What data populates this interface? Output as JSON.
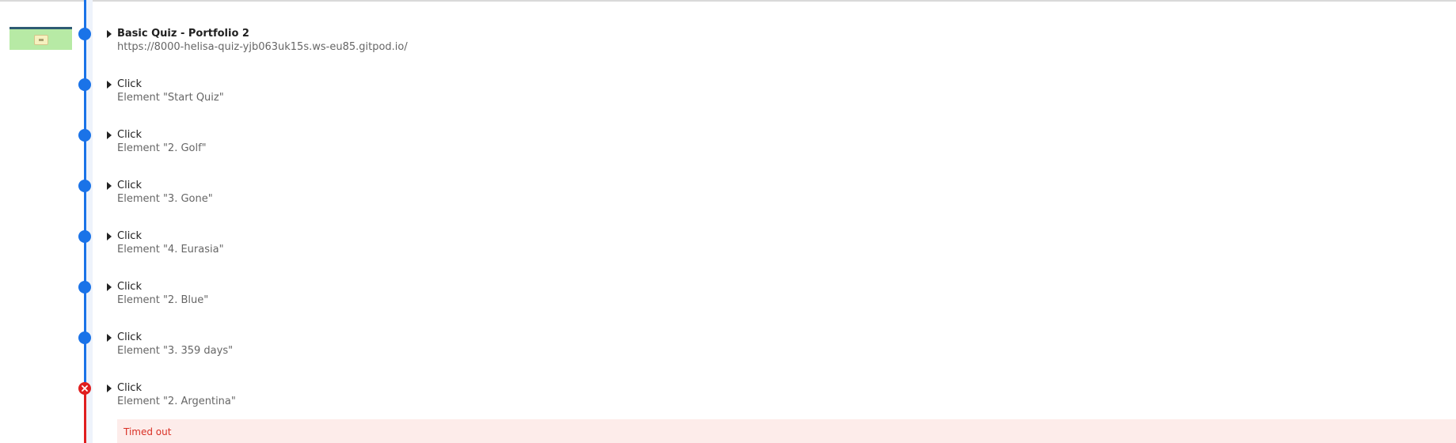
{
  "steps": [
    {
      "title": "Basic Quiz - Portfolio 2",
      "subtitle": "https://8000-helisa-quiz-yjb063uk15s.ws-eu85.gitpod.io/",
      "status": "ok"
    },
    {
      "title": "Click",
      "subtitle": "Element \"Start Quiz\"",
      "status": "ok"
    },
    {
      "title": "Click",
      "subtitle": "Element \"2. Golf\"",
      "status": "ok"
    },
    {
      "title": "Click",
      "subtitle": "Element \"3. Gone\"",
      "status": "ok"
    },
    {
      "title": "Click",
      "subtitle": "Element \"4. Eurasia\"",
      "status": "ok"
    },
    {
      "title": "Click",
      "subtitle": "Element \"2. Blue\"",
      "status": "ok"
    },
    {
      "title": "Click",
      "subtitle": "Element \"3. 359 days\"",
      "status": "ok"
    },
    {
      "title": "Click",
      "subtitle": "Element \"2. Argentina\"",
      "status": "error"
    }
  ],
  "error": {
    "message": "Timed out"
  },
  "colors": {
    "timeline_ok": "#1a73e8",
    "timeline_error": "#e01f1f",
    "error_bg": "#fdecea",
    "error_text": "#d93025"
  },
  "icons": {
    "expand": "caret-right-icon",
    "step_ok": "dot-icon",
    "step_error": "x-circle-icon"
  }
}
